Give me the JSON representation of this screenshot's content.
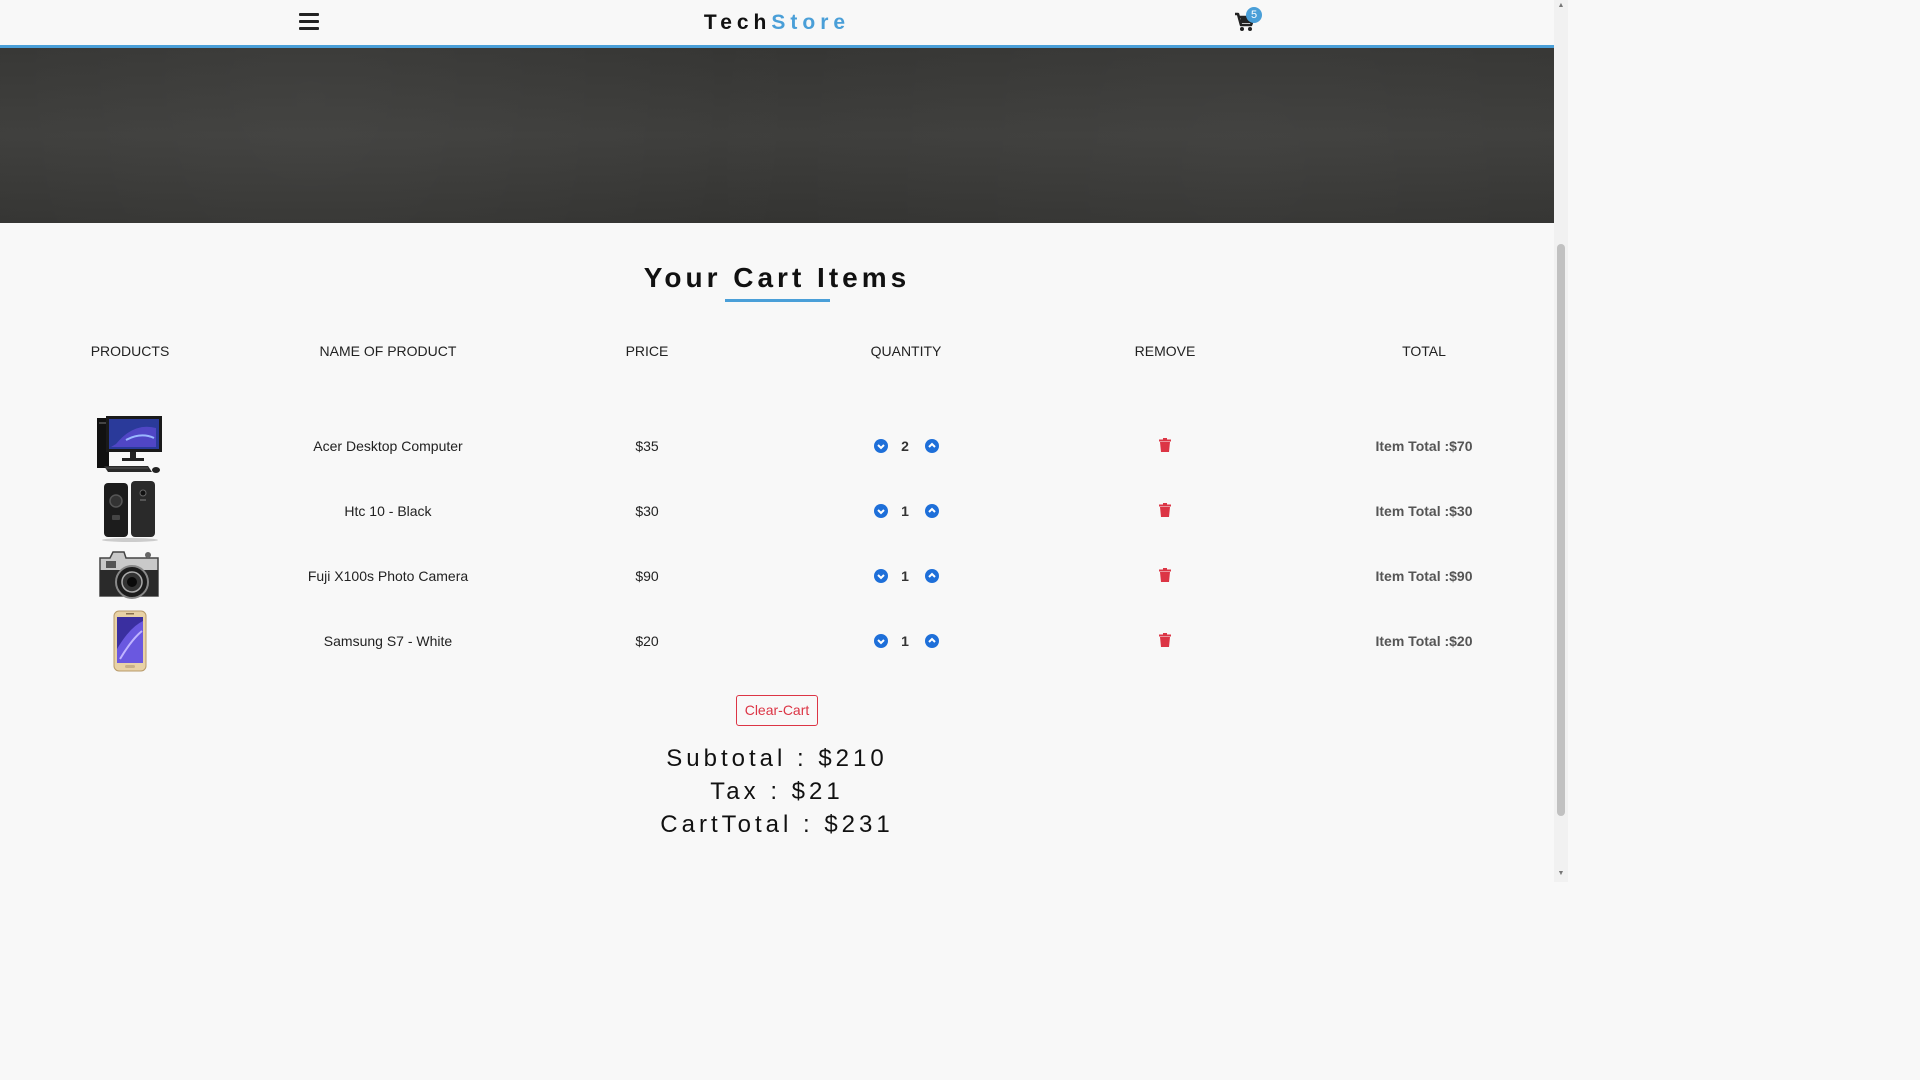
{
  "navbar": {
    "brand_part1": "Tech",
    "brand_part2": "Store",
    "cart_count": "5",
    "accent_color": "#4a9fd8"
  },
  "cart": {
    "title": "Your Cart Items",
    "headers": [
      "PRODUCTS",
      "NAME OF PRODUCT",
      "PRICE",
      "QUANTITY",
      "REMOVE",
      "TOTAL"
    ],
    "items": [
      {
        "image": "desktop-computer",
        "name": "Acer Desktop Computer",
        "price": "$35",
        "quantity": "2",
        "total": "Item Total :$70"
      },
      {
        "image": "smartphone-black",
        "name": "Htc 10 - Black",
        "price": "$30",
        "quantity": "1",
        "total": "Item Total :$30"
      },
      {
        "image": "photo-camera",
        "name": "Fuji X100s Photo Camera",
        "price": "$90",
        "quantity": "1",
        "total": "Item Total :$90"
      },
      {
        "image": "smartphone-white",
        "name": "Samsung S7 - White",
        "price": "$20",
        "quantity": "1",
        "total": "Item Total :$20"
      }
    ],
    "clear_label": "Clear-Cart",
    "subtotal": "Subtotal : $210",
    "tax": "Tax : $21",
    "cart_total": "CartTotal : $231"
  },
  "icons": {
    "menu": "hamburger-icon",
    "cart": "shopping-cart-icon",
    "decrease": "chevron-down-circle-icon",
    "increase": "chevron-up-circle-icon",
    "remove": "trash-icon"
  },
  "colors": {
    "remove": "#dc3545",
    "quantity_buttons": "#1e6fd9"
  }
}
